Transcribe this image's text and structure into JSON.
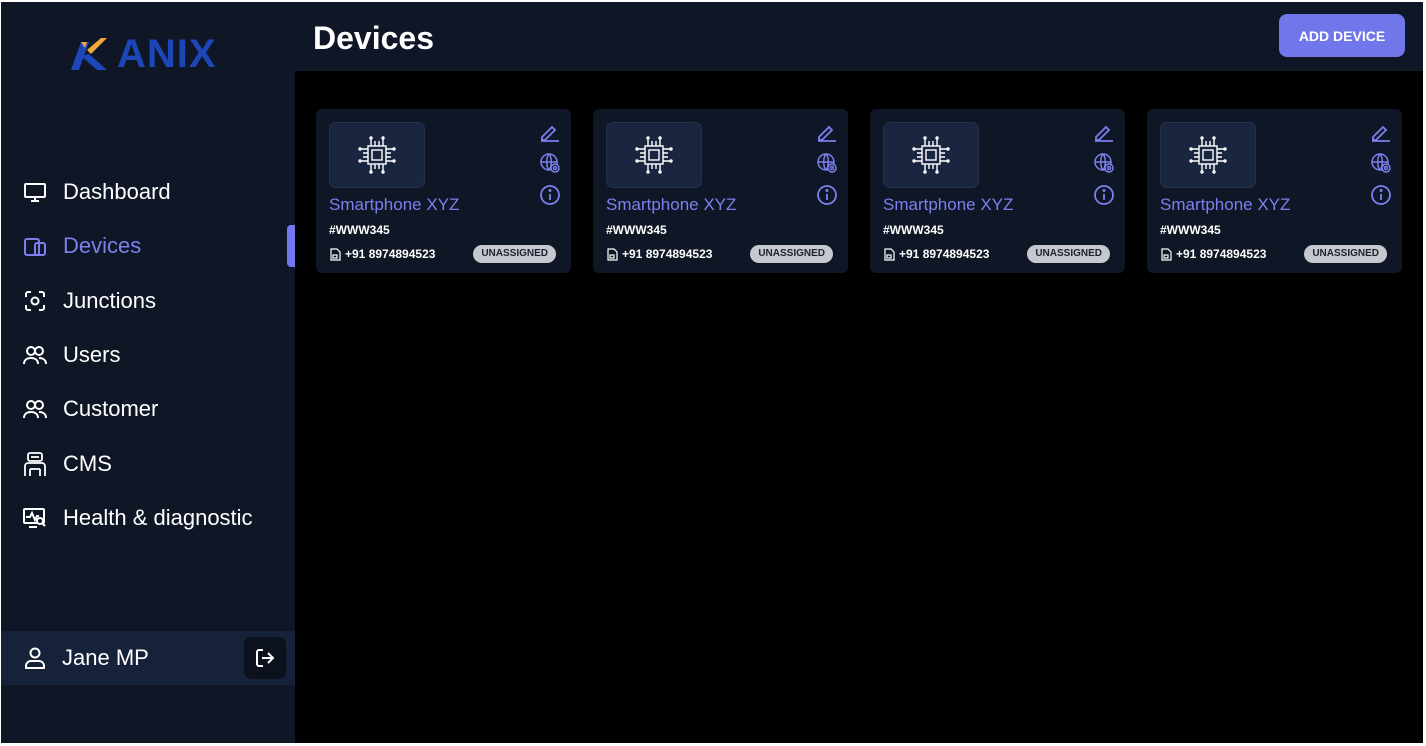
{
  "brand": {
    "logo_text": "ANIX"
  },
  "header": {
    "title": "Devices",
    "add_button_label": "ADD DEVICE"
  },
  "sidebar": {
    "items": [
      {
        "label": "Dashboard",
        "icon": "monitor-icon",
        "active": false
      },
      {
        "label": "Devices",
        "icon": "devices-icon",
        "active": true
      },
      {
        "label": "Junctions",
        "icon": "junction-icon",
        "active": false
      },
      {
        "label": "Users",
        "icon": "users-icon",
        "active": false
      },
      {
        "label": "Customer",
        "icon": "customer-icon",
        "active": false
      },
      {
        "label": "CMS",
        "icon": "cms-icon",
        "active": false
      },
      {
        "label": "Health & diagnostic",
        "icon": "health-icon",
        "active": false
      }
    ],
    "user": {
      "name": "Jane MP",
      "icon": "user-icon",
      "logout_icon": "logout-icon"
    }
  },
  "devices": [
    {
      "name": "Smartphone XYZ",
      "id": "#WWW345",
      "phone": "+91 8974894523",
      "status": "UNASSIGNED"
    },
    {
      "name": "Smartphone XYZ",
      "id": "#WWW345",
      "phone": "+91 8974894523",
      "status": "UNASSIGNED"
    },
    {
      "name": "Smartphone XYZ",
      "id": "#WWW345",
      "phone": "+91 8974894523",
      "status": "UNASSIGNED"
    },
    {
      "name": "Smartphone XYZ",
      "id": "#WWW345",
      "phone": "+91 8974894523",
      "status": "UNASSIGNED"
    }
  ],
  "colors": {
    "accent": "#7177EA",
    "sidebar_bg": "#0F1726",
    "content_bg": "#000000",
    "logo": "#1D47B8",
    "badge_bg": "#C6C8CF"
  }
}
